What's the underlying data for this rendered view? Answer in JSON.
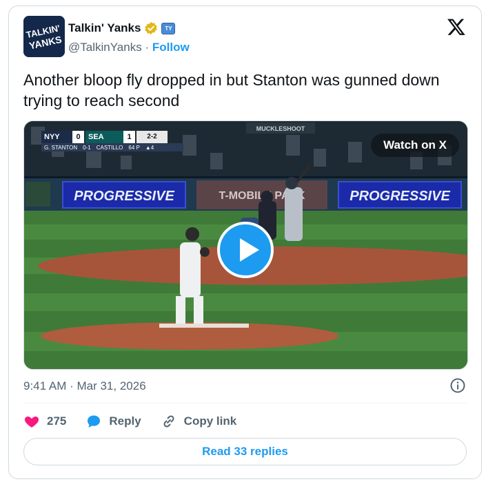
{
  "author": {
    "name": "Talkin' Yanks",
    "handle": "@TalkinYanks",
    "separator": "·",
    "follow_label": "Follow",
    "avatar_text_1": "TALKIN'",
    "avatar_text_2": "YANKS",
    "verified": true
  },
  "tweet": {
    "text": "Another bloop fly dropped in but Stanton was gunned down trying to reach second",
    "timestamp": "9:41 AM · Mar 31, 2026"
  },
  "media": {
    "watch_label": "Watch on X",
    "scorebug": {
      "away_team": "NYY",
      "away_score": "0",
      "home_team": "SEA",
      "home_score": "1",
      "count": "2-2",
      "batter": "G. STANTON",
      "batter_line": "0-1",
      "pitcher": "CASTILLO",
      "pitch_count": "64 P",
      "inning": "▲4"
    },
    "ads": {
      "left": "PROGRESSIVE",
      "right": "PROGRESSIVE",
      "center": "T-MOBILE PARK",
      "stand_sign": "MUCKLESHOOT"
    }
  },
  "actions": {
    "like_count": "275",
    "reply_label": "Reply",
    "copy_label": "Copy link",
    "read_replies_label": "Read 33 replies"
  },
  "colors": {
    "accent": "#1d9bf0",
    "like": "#f91880",
    "text": "#0f1419",
    "muted": "#536471"
  }
}
